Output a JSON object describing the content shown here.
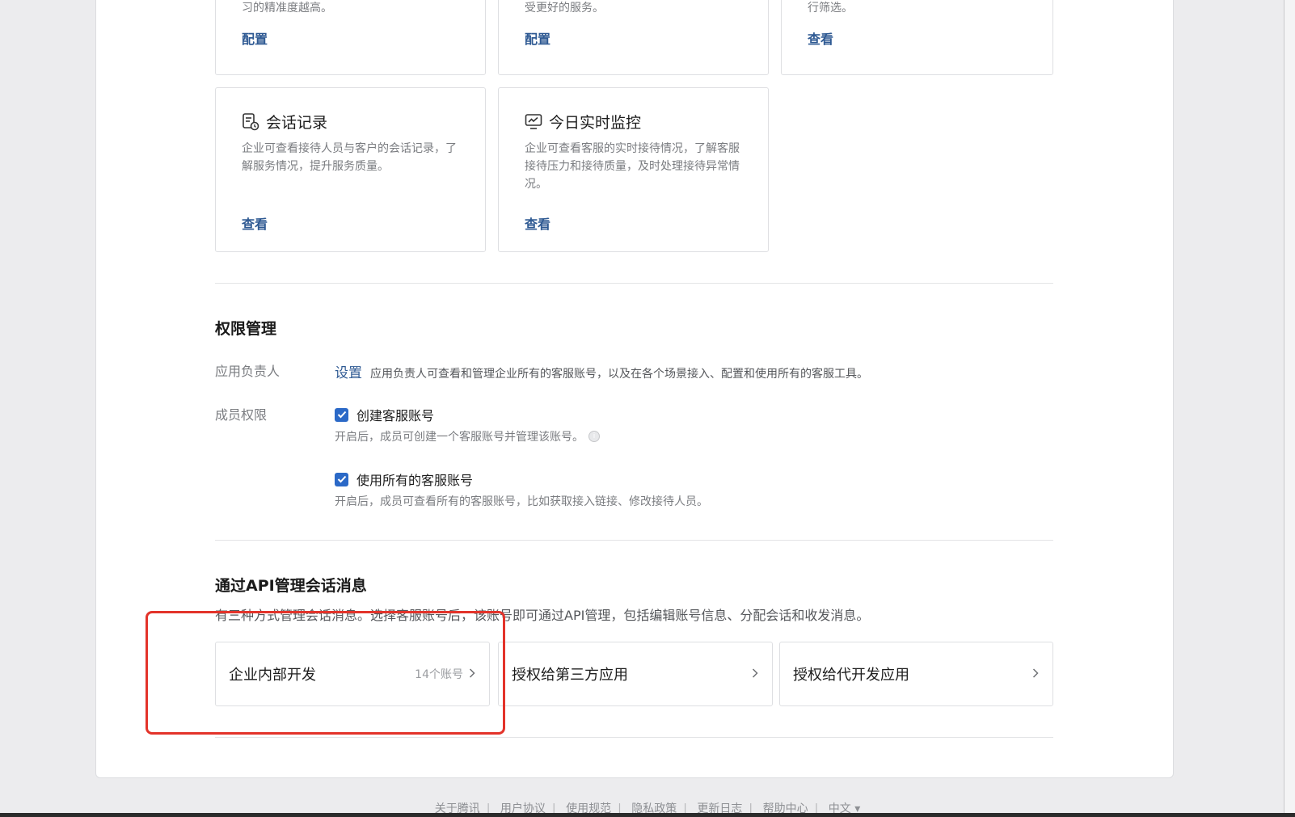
{
  "top_cards": [
    {
      "line": "习的精准度越高。",
      "action": "配置"
    },
    {
      "line": "受更好的服务。",
      "action": "配置"
    },
    {
      "line": "行筛选。",
      "action": "查看"
    }
  ],
  "mid_cards": [
    {
      "title": "会话记录",
      "desc": "企业可查看接待人员与客户的会话记录，了解服务情况，提升服务质量。",
      "action": "查看",
      "icon": "chat-record-icon"
    },
    {
      "title": "今日实时监控",
      "desc": "企业可查看客服的实时接待情况，了解客服接待压力和接待质量，及时处理接待异常情况。",
      "action": "查看",
      "icon": "monitor-icon"
    }
  ],
  "permissions": {
    "title": "权限管理",
    "owner_label": "应用负责人",
    "owner_link": "设置",
    "owner_note": "应用负责人可查看和管理企业所有的客服账号，以及在各个场景接入、配置和使用所有的客服工具。",
    "member_label": "成员权限",
    "options": [
      {
        "label": "创建客服账号",
        "checked": true,
        "hint": "开启后，成员可创建一个客服账号并管理该账号。"
      },
      {
        "label": "使用所有的客服账号",
        "checked": true,
        "hint": "开启后，成员可查看所有的客服账号，比如获取接入链接、修改接待人员。"
      }
    ]
  },
  "api": {
    "title": "通过API管理会话消息",
    "desc": "有三种方式管理会话消息。选择客服账号后，该账号即可通过API管理，包括编辑账号信息、分配会话和收发消息。",
    "cards": [
      {
        "name": "企业内部开发",
        "count": "14个账号"
      },
      {
        "name": "授权给第三方应用",
        "count": ""
      },
      {
        "name": "授权给代开发应用",
        "count": ""
      }
    ]
  },
  "footer": {
    "items": [
      "关于腾讯",
      "用户协议",
      "使用规范",
      "隐私政策",
      "更新日志",
      "帮助中心"
    ],
    "language": "中文"
  },
  "colors": {
    "accent": "#2f5a93",
    "checkbox": "#2b69c7",
    "highlight": "#e3332a"
  }
}
